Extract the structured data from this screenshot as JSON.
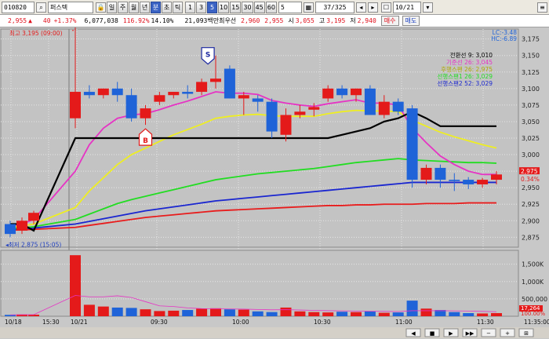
{
  "toolbar": {
    "code": "010820",
    "name": "퍼스텍",
    "period_buttons": [
      "일",
      "주",
      "월",
      "년",
      "분",
      "초",
      "틱"
    ],
    "interval_buttons": [
      "1",
      "3",
      "5",
      "10",
      "15",
      "30",
      "45",
      "60"
    ],
    "active_interval": "5",
    "active_period": "분",
    "interval_select": "5",
    "count": "37/325",
    "date": "10/21"
  },
  "quote": {
    "price": "2,955",
    "change": "40",
    "change_pct": "+1.37%",
    "volume": "6,077,038",
    "vol_ratio": "116.92%",
    "turnover": "14.10%",
    "amount": "21,093백만",
    "best_ask_label": "최우선",
    "best_ask": "2,960",
    "best_bid": "2,955",
    "open_label": "시",
    "open": "3,055",
    "high_label": "고",
    "high": "3,195",
    "low_label": "저",
    "low": "2,940",
    "buy_label": "매수",
    "sell_label": "매도"
  },
  "chart_data": [
    {
      "type": "candlestick",
      "name": "price",
      "x_labels": [
        "10/18",
        "15:30",
        "10/21",
        "09:30",
        "10:00",
        "10:30",
        "11:00",
        "11:30"
      ],
      "y_ticks": [
        2875,
        2900,
        2925,
        2950,
        2975,
        3000,
        3025,
        3050,
        3075,
        3100,
        3125,
        3150,
        3175
      ],
      "y_tick_labels": [
        "2,875",
        "2,900",
        "2,925",
        "2,950",
        "2,975",
        "3,000",
        "3,025",
        "3,050",
        "3,075",
        "3,100",
        "3,125",
        "3,150",
        "3,175"
      ],
      "ylim": [
        2860,
        3190
      ],
      "candles": [
        {
          "o": 2895,
          "h": 2900,
          "l": 2875,
          "c": 2880
        },
        {
          "o": 2885,
          "h": 2905,
          "l": 2880,
          "c": 2900
        },
        {
          "o": 2900,
          "h": 2915,
          "l": 2895,
          "c": 2912
        },
        {
          "o": 3055,
          "h": 3195,
          "l": 3040,
          "c": 3095
        },
        {
          "o": 3095,
          "h": 3105,
          "l": 3085,
          "c": 3090
        },
        {
          "o": 3090,
          "h": 3100,
          "l": 3085,
          "c": 3100
        },
        {
          "o": 3100,
          "h": 3110,
          "l": 3080,
          "c": 3090
        },
        {
          "o": 3090,
          "h": 3100,
          "l": 3050,
          "c": 3055
        },
        {
          "o": 3055,
          "h": 3075,
          "l": 3045,
          "c": 3070
        },
        {
          "o": 3080,
          "h": 3095,
          "l": 3075,
          "c": 3090
        },
        {
          "o": 3090,
          "h": 3095,
          "l": 3085,
          "c": 3095
        },
        {
          "o": 3095,
          "h": 3105,
          "l": 3085,
          "c": 3092
        },
        {
          "o": 3095,
          "h": 3115,
          "l": 3090,
          "c": 3110
        },
        {
          "o": 3110,
          "h": 3150,
          "l": 3100,
          "c": 3115
        },
        {
          "o": 3130,
          "h": 3135,
          "l": 3085,
          "c": 3085
        },
        {
          "o": 3085,
          "h": 3095,
          "l": 3060,
          "c": 3090
        },
        {
          "o": 3085,
          "h": 3090,
          "l": 3065,
          "c": 3080
        },
        {
          "o": 3080,
          "h": 3085,
          "l": 3025,
          "c": 3035
        },
        {
          "o": 3030,
          "h": 3070,
          "l": 3020,
          "c": 3060
        },
        {
          "o": 3060,
          "h": 3075,
          "l": 3055,
          "c": 3065
        },
        {
          "o": 3068,
          "h": 3078,
          "l": 3058,
          "c": 3072
        },
        {
          "o": 3085,
          "h": 3105,
          "l": 3080,
          "c": 3100
        },
        {
          "o": 3100,
          "h": 3105,
          "l": 3085,
          "c": 3090
        },
        {
          "o": 3090,
          "h": 3100,
          "l": 3080,
          "c": 3100
        },
        {
          "o": 3100,
          "h": 3105,
          "l": 3060,
          "c": 3060
        },
        {
          "o": 3060,
          "h": 3090,
          "l": 3055,
          "c": 3080
        },
        {
          "o": 3080,
          "h": 3085,
          "l": 3060,
          "c": 3065
        },
        {
          "o": 3070,
          "h": 3075,
          "l": 2950,
          "c": 2962
        },
        {
          "o": 2962,
          "h": 2985,
          "l": 2955,
          "c": 2980
        },
        {
          "o": 2980,
          "h": 2985,
          "l": 2950,
          "c": 2962
        },
        {
          "o": 2962,
          "h": 2972,
          "l": 2945,
          "c": 2960
        },
        {
          "o": 2962,
          "h": 2966,
          "l": 2948,
          "c": 2955
        },
        {
          "o": 2955,
          "h": 2965,
          "l": 2950,
          "c": 2962
        },
        {
          "o": 2962,
          "h": 2975,
          "l": 2955,
          "c": 2970
        }
      ],
      "moving_averages": [
        {
          "name": "전환선",
          "period": "9",
          "value": "3,010",
          "color": "#000000",
          "values": [
            2895,
            2895,
            2885,
            3025,
            3025,
            3025,
            3025,
            3025,
            3025,
            3025,
            3025,
            3025,
            3025,
            3025,
            3025,
            3025,
            3025,
            3025,
            3025,
            3025,
            3025,
            3025,
            3030,
            3035,
            3040,
            3050,
            3055,
            3065,
            3055,
            3043,
            3043,
            3043,
            3043,
            3043
          ]
        },
        {
          "name": "기준선",
          "period": "26",
          "value": "3,045",
          "color": "#e633c4",
          "values": [
            2893,
            2895,
            2902,
            2975,
            3015,
            3040,
            3055,
            3060,
            3062,
            3068,
            3075,
            3081,
            3088,
            3095,
            3093,
            3093,
            3091,
            3082,
            3078,
            3075,
            3073,
            3077,
            3080,
            3083,
            3078,
            3078,
            3075,
            3040,
            3018,
            2998,
            2985,
            2975,
            2970,
            2970
          ]
        },
        {
          "name": "후행스팬",
          "period": "26",
          "value": "2,975",
          "color": "#eeee22",
          "values": [
            2890,
            2892,
            2895,
            2920,
            2945,
            2965,
            2985,
            3000,
            3010,
            3020,
            3030,
            3038,
            3046,
            3055,
            3058,
            3060,
            3061,
            3059,
            3058,
            3058,
            3058,
            3062,
            3065,
            3067,
            3066,
            3066,
            3065,
            3052,
            3043,
            3034,
            3027,
            3021,
            3015,
            3010
          ]
        },
        {
          "name": "선행스팬1",
          "period": "26",
          "value": "3,029",
          "color": "#22dd22",
          "values": [
            2888,
            2889,
            2891,
            2902,
            2910,
            2918,
            2926,
            2932,
            2937,
            2942,
            2947,
            2952,
            2957,
            2962,
            2965,
            2968,
            2971,
            2973,
            2975,
            2977,
            2979,
            2982,
            2985,
            2988,
            2990,
            2992,
            2994,
            2992,
            2991,
            2990,
            2989,
            2988,
            2988,
            2987
          ]
        },
        {
          "name": "선행스팬2",
          "period": "52",
          "value": "3,029",
          "color": "#1a26d0",
          "values": [
            2887,
            2888,
            2889,
            2895,
            2899,
            2903,
            2907,
            2911,
            2915,
            2918,
            2921,
            2924,
            2927,
            2930,
            2932,
            2934,
            2936,
            2938,
            2940,
            2942,
            2944,
            2946,
            2948,
            2950,
            2952,
            2954,
            2956,
            2958,
            2958,
            2958,
            2958,
            2958,
            2958,
            2958
          ]
        },
        {
          "name": "MA120",
          "period": "120",
          "value": "",
          "color": "#e81c1c",
          "values": [
            2886,
            2886,
            2887,
            2890,
            2893,
            2896,
            2899,
            2902,
            2905,
            2907,
            2909,
            2911,
            2913,
            2915,
            2916,
            2917,
            2918,
            2919,
            2920,
            2921,
            2922,
            2923,
            2923,
            2924,
            2924,
            2925,
            2925,
            2925,
            2926,
            2926,
            2926,
            2927,
            2927,
            2927
          ]
        }
      ],
      "annotations": {
        "high": "최고 3,195 (09:00)",
        "low": "최저 2,875 (15:05)",
        "lc": "LC:-3.48",
        "hc": "HC:-6.89",
        "price_tag": "2,975",
        "pct_tag": "0.34%",
        "buy_signal": "B",
        "sell_signal": "S"
      }
    },
    {
      "type": "bar",
      "name": "volume",
      "y_tick_labels": [
        "1,500K",
        "1,000K",
        "500,000"
      ],
      "y_ticks": [
        1500000,
        1000000,
        500000
      ],
      "ylim": [
        0,
        1900000
      ],
      "values": [
        40000,
        50000,
        45000,
        1760000,
        330000,
        280000,
        250000,
        240000,
        200000,
        150000,
        160000,
        180000,
        220000,
        230000,
        200000,
        190000,
        140000,
        120000,
        250000,
        140000,
        120000,
        110000,
        130000,
        120000,
        140000,
        100000,
        110000,
        450000,
        220000,
        180000,
        120000,
        90000,
        80000,
        90000
      ],
      "up": [
        false,
        true,
        true,
        true,
        true,
        true,
        false,
        false,
        true,
        true,
        true,
        false,
        true,
        true,
        false,
        true,
        false,
        false,
        true,
        true,
        true,
        true,
        false,
        true,
        false,
        true,
        false,
        false,
        true,
        false,
        false,
        false,
        true,
        true
      ],
      "ma_values": [
        40000,
        45000,
        45000,
        600000,
        560000,
        560000,
        590000,
        540000,
        420000,
        300000,
        280000,
        240000,
        220000,
        215000,
        210000,
        205000,
        195000,
        185000,
        190000,
        180000,
        170000,
        160000,
        155000,
        150000,
        145000,
        140000,
        135000,
        160000,
        160000,
        160000,
        155000,
        150000,
        140000,
        130000
      ],
      "current_label": "17,264",
      "pct_label": "100.00%"
    }
  ],
  "time_axis_end": "11:35:00",
  "bottom_controls": [
    "◀",
    "■",
    "▶",
    "▶▶",
    "−",
    "+",
    "⊞"
  ]
}
